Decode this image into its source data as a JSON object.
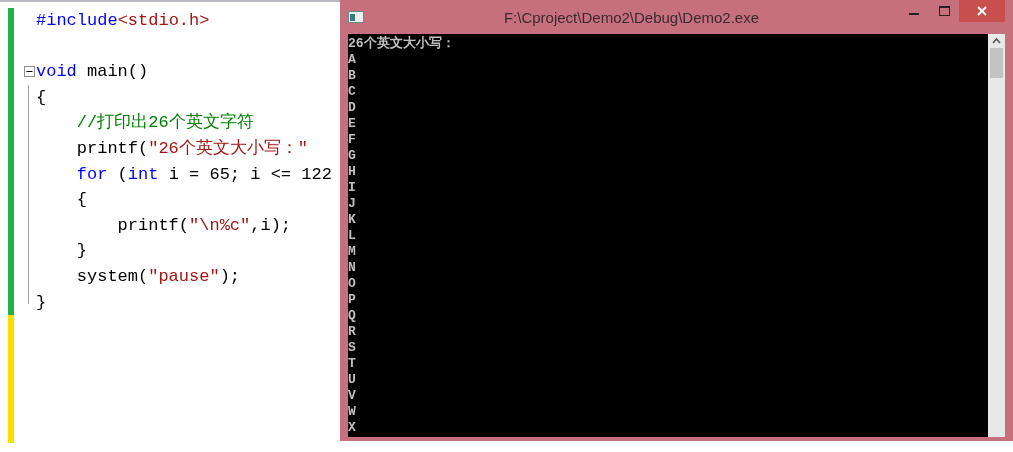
{
  "editor": {
    "lines": [
      {
        "saved": true,
        "tokens": [
          {
            "kind": "keyword",
            "text": "#include"
          },
          {
            "kind": "string",
            "text": "<stdio.h>"
          }
        ]
      },
      {
        "saved": true
      },
      {
        "saved": true,
        "fold": {
          "expanded": true
        },
        "tokens": [
          {
            "kind": "keyword",
            "text": "void"
          },
          {
            "kind": "plain",
            "text": " main()"
          }
        ]
      },
      {
        "saved": true,
        "tokens": [
          {
            "kind": "plain",
            "text": "{"
          }
        ]
      },
      {
        "saved": true,
        "tokens": [
          {
            "kind": "comment",
            "text": "    //打印出26个英文字符"
          }
        ]
      },
      {
        "saved": true,
        "tokens": [
          {
            "kind": "plain",
            "text": "    printf("
          },
          {
            "kind": "string",
            "text": "\"26个英文大小写：\""
          }
        ]
      },
      {
        "saved": true,
        "tokens": [
          {
            "kind": "keyword",
            "text": "    for"
          },
          {
            "kind": "plain",
            "text": " ("
          },
          {
            "kind": "keyword",
            "text": "int"
          },
          {
            "kind": "plain",
            "text": " i = 65; i <= 122"
          }
        ]
      },
      {
        "saved": true,
        "tokens": [
          {
            "kind": "plain",
            "text": "    {"
          }
        ]
      },
      {
        "saved": true,
        "tokens": [
          {
            "kind": "plain",
            "text": "        printf("
          },
          {
            "kind": "string",
            "text": "\"\\n%c\""
          },
          {
            "kind": "plain",
            "text": ",i);"
          }
        ]
      },
      {
        "saved": true,
        "tokens": [
          {
            "kind": "plain",
            "text": "    }"
          }
        ]
      },
      {
        "saved": true,
        "tokens": [
          {
            "kind": "plain",
            "text": "    system("
          },
          {
            "kind": "string",
            "text": "\"pause\""
          },
          {
            "kind": "plain",
            "text": ");"
          }
        ]
      },
      {
        "saved": true,
        "tokens": [
          {
            "kind": "plain",
            "text": "}"
          }
        ]
      },
      {
        "saved": false
      },
      {
        "saved": false
      },
      {
        "saved": false
      },
      {
        "saved": false
      },
      {
        "saved": false
      }
    ]
  },
  "console": {
    "title": "F:\\Cproject\\Demo2\\Debug\\Demo2.exe",
    "output": [
      "26个英文大小写：",
      "A",
      "B",
      "C",
      "D",
      "E",
      "F",
      "G",
      "H",
      "I",
      "J",
      "K",
      "L",
      "M",
      "N",
      "O",
      "P",
      "Q",
      "R",
      "S",
      "T",
      "U",
      "V",
      "W",
      "X"
    ]
  }
}
